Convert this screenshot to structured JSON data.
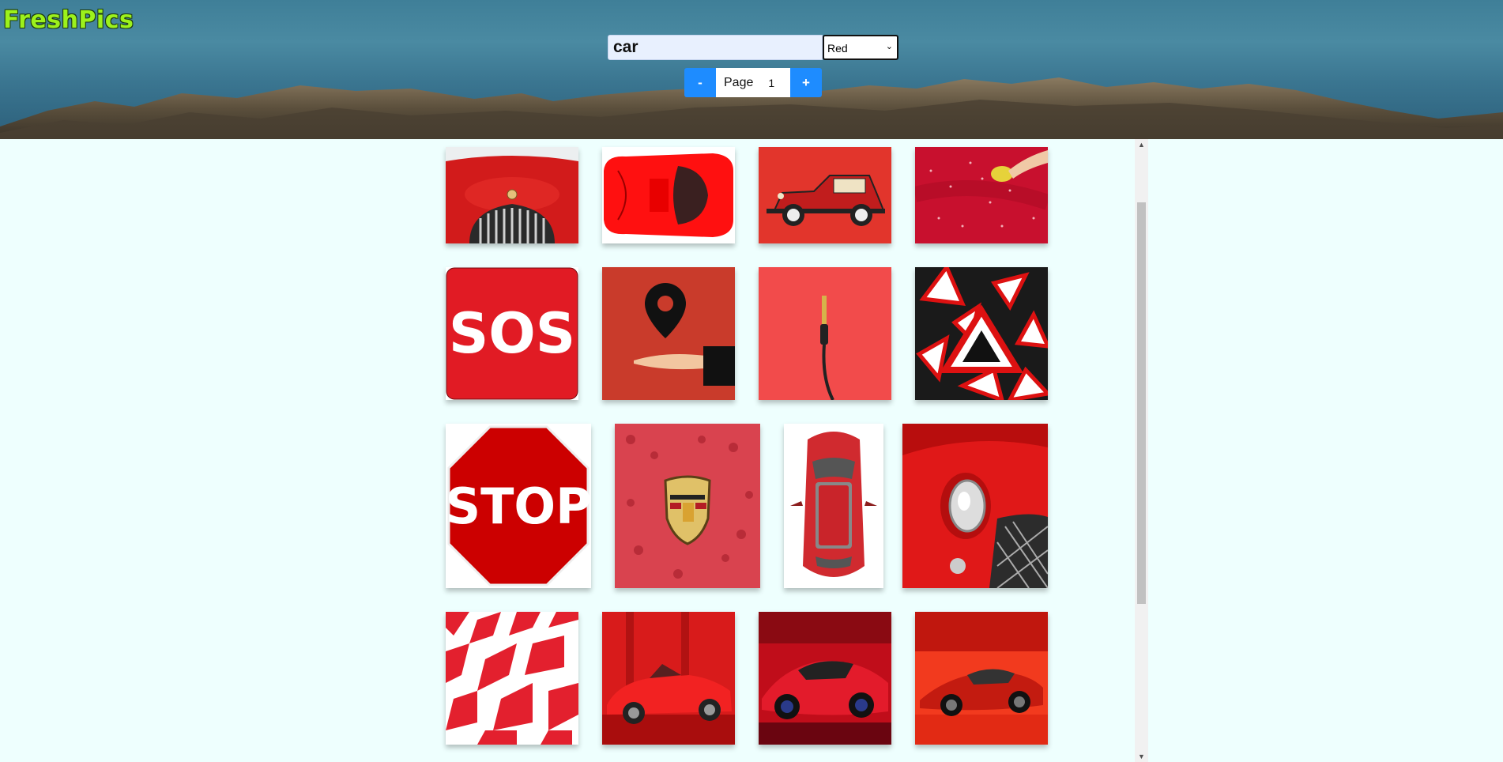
{
  "header": {
    "logo": "FreshPics",
    "search_value": "car",
    "color_filter": "Red",
    "pager": {
      "minus_label": "-",
      "page_label": "Page",
      "page_number": "1",
      "plus_label": "+"
    }
  },
  "colors": {
    "accent": "#1e8cff",
    "logo": "#9cf11c",
    "background": "#eefffe"
  },
  "gallery": {
    "rows": [
      [
        "red-classic-car-grille",
        "red-sports-car-topview",
        "red-vintage-car",
        "red-car-wash"
      ],
      [
        "sos-sign",
        "location-pin-hand",
        "audio-jack-cable",
        "warning-triangles-pattern"
      ],
      [
        "stop-sign",
        "porsche-emblem",
        "red-car-topview",
        "red-car-headlight"
      ],
      [
        "red-checkered-pattern",
        "red-convertible",
        "red-concept-car",
        "red-supercar"
      ]
    ],
    "text_in_images": {
      "sos": "SOS",
      "stop": "STOP"
    }
  }
}
